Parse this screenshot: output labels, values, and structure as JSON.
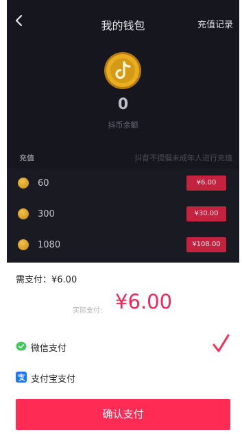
{
  "header": {
    "title": "我的钱包",
    "history_link": "充值记录"
  },
  "wallet": {
    "balance": "0",
    "balance_label": "抖币余额"
  },
  "topup": {
    "label": "充值",
    "note": "抖音不提倡未成年人进行充值",
    "options": [
      {
        "amount": "60",
        "price": "¥6.00"
      },
      {
        "amount": "300",
        "price": "¥30.00"
      },
      {
        "amount": "1080",
        "price": "¥108.00"
      }
    ]
  },
  "payment": {
    "need_label": "需支付：¥6.00",
    "actual_label": "实际支付:",
    "actual_amount": "¥6.00",
    "methods": [
      {
        "label": "微信支付",
        "icon": "wechat-pay-icon",
        "selected": true
      },
      {
        "label": "支付宝支付",
        "icon": "alipay-icon",
        "selected": false
      }
    ],
    "confirm_label": "确认支付"
  },
  "colors": {
    "accent": "#fe2c55",
    "price_button": "#c4233f",
    "dark_bg": "#16161e"
  }
}
